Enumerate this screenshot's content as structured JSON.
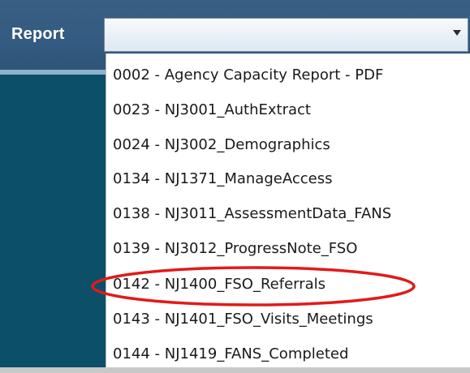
{
  "report_label": "Report",
  "select": {
    "value": "",
    "arrow_icon": "chevron-down-icon"
  },
  "dropdown": {
    "items": [
      {
        "label": "0002 - Agency Capacity Report - PDF"
      },
      {
        "label": "0023 - NJ3001_AuthExtract"
      },
      {
        "label": "0024 - NJ3002_Demographics"
      },
      {
        "label": "0134 - NJ1371_ManageAccess"
      },
      {
        "label": "0138 - NJ3011_AssessmentData_FANS"
      },
      {
        "label": "0139 - NJ3012_ProgressNote_FSO"
      },
      {
        "label": "0142 - NJ1400_FSO_Referrals"
      },
      {
        "label": "0143 - NJ1401_FSO_Visits_Meetings"
      },
      {
        "label": "0144 - NJ1419_FANS_Completed"
      }
    ]
  },
  "colors": {
    "header": "#335a80",
    "panel": "#0c4f68",
    "highlight": "#e01b1b"
  }
}
